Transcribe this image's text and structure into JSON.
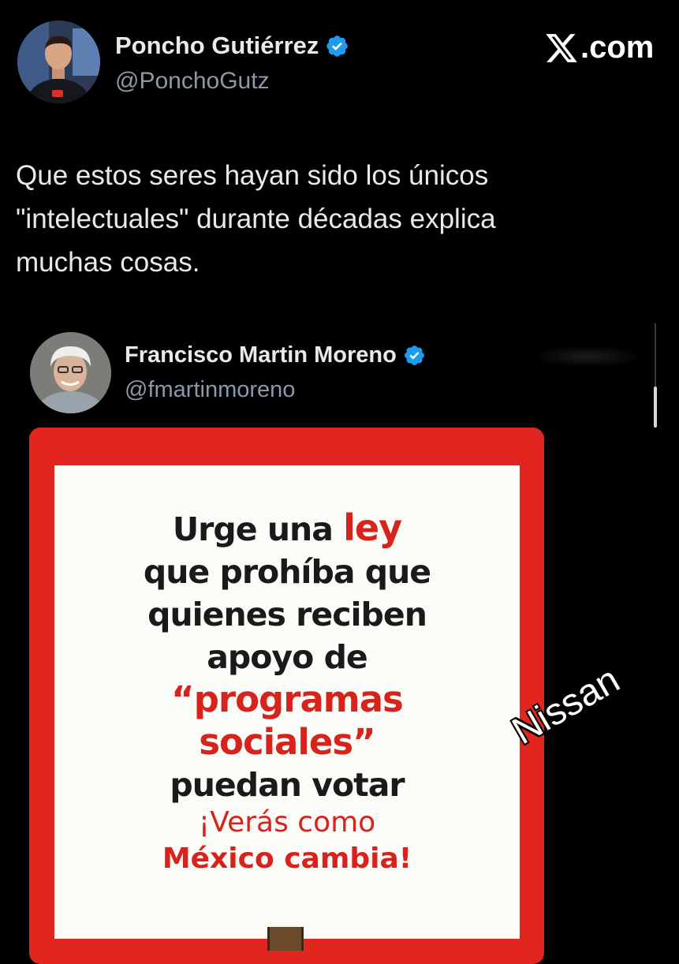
{
  "post": {
    "author_name": "Poncho Gutiérrez",
    "author_handle": "@PonchoGutz",
    "brand": ".com",
    "text_lines": [
      "Que estos seres hayan sido los únicos",
      "\"intelectuales\" durante décadas explica",
      "muchas cosas."
    ]
  },
  "quoted": {
    "author_name": "Francisco Martin Moreno",
    "author_handle": "@fmartinmoreno"
  },
  "sign": {
    "line1_a": "Urge una ",
    "line1_b": "ley",
    "line2": "que prohíba que",
    "line3": "quienes reciben",
    "line4": "apoyo de",
    "line5": "“programas",
    "line6": "sociales”",
    "line7": "puedan votar",
    "sub1_a": "¡",
    "sub1_b": "Verás como",
    "sub2": "México cambia!"
  },
  "watermark": "Nissan",
  "colors": {
    "verified_blue": "#1d9bf0",
    "sign_red": "#e2251f",
    "handle_gray": "#8b98a5"
  },
  "icons": {
    "verified": "verified-badge-icon",
    "brand": "x-logo-icon"
  }
}
